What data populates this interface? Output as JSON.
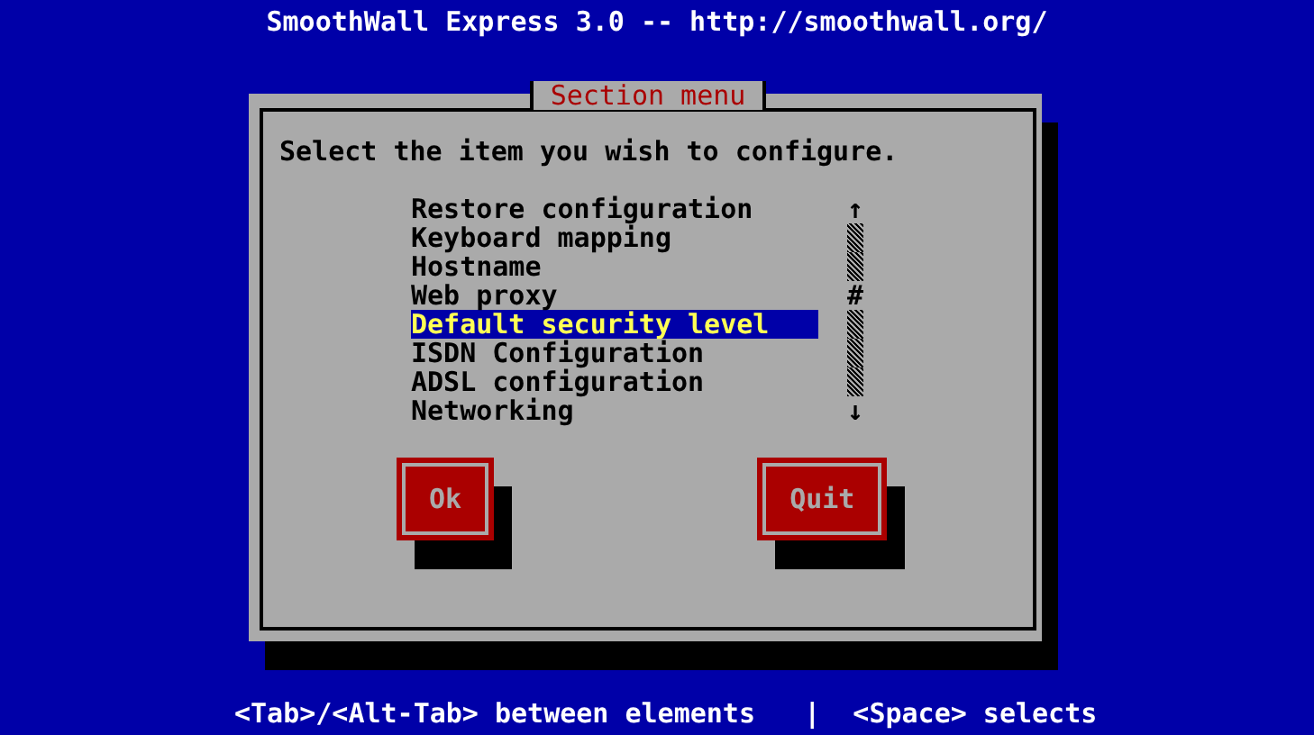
{
  "header": {
    "title": "SmoothWall Express 3.0 -- http://smoothwall.org/"
  },
  "dialog": {
    "title": "Section menu",
    "prompt": "Select the item you wish to configure.",
    "items": [
      {
        "label": "Restore configuration",
        "selected": false
      },
      {
        "label": "Keyboard mapping",
        "selected": false
      },
      {
        "label": "Hostname",
        "selected": false
      },
      {
        "label": "Web proxy",
        "selected": false
      },
      {
        "label": "Default security level",
        "selected": true
      },
      {
        "label": "ISDN Configuration",
        "selected": false
      },
      {
        "label": "ADSL configuration",
        "selected": false
      },
      {
        "label": "Networking",
        "selected": false
      }
    ],
    "scrollbar": {
      "up": "↑",
      "thumb": "#",
      "down": "↓"
    },
    "buttons": [
      "Ok",
      "Quit"
    ]
  },
  "help_line": "<Tab>/<Alt-Tab> between elements   |  <Space> selects"
}
